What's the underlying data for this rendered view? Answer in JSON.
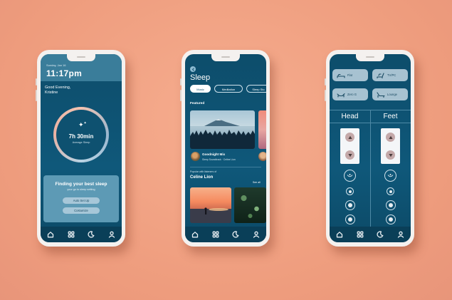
{
  "phone1": {
    "date": "Sunday, Jan 16",
    "time": "11:17pm",
    "greeting_line1": "Good Evening,",
    "greeting_line2": "Kristine",
    "sleep_duration": "7h 30min",
    "sleep_label": "Average Sleep",
    "card_title": "Finding your best sleep",
    "card_subtitle": "your go to sleep setting",
    "auto_setup": "Auto Set Up",
    "customize": "Costumize"
  },
  "phone2": {
    "title": "Sleep",
    "chips": [
      "Music",
      "Meditation",
      "Sleep Sto"
    ],
    "featured_label": "Featured",
    "mix_title": "Goodnight Mix",
    "mix_subtitle": "Sleep Soundtrack · Celine Lion",
    "popular_label": "Popular with listeners of",
    "popular_artist": "Celine Lion",
    "see_all": "See all"
  },
  "phone3": {
    "modes": [
      "Flat",
      "TV/PC",
      "Zero G",
      "Lounge"
    ],
    "head_label": "Head",
    "feet_label": "Feet"
  },
  "tab_icons": [
    "home-icon",
    "grid-icon",
    "moon-icon",
    "person-icon"
  ],
  "colors": {
    "background": "#f0a283",
    "screen": "#0d4d6b",
    "card": "#5d9ab5",
    "pill": "#a7c7d8"
  }
}
